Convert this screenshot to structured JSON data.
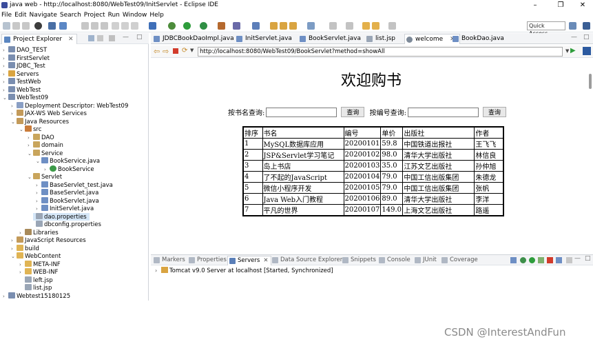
{
  "window": {
    "title": "java web - http://localhost:8080/WebTest09/InitServlet - Eclipse IDE",
    "minimize": "–",
    "maximize": "❐",
    "close": "✕"
  },
  "menu": [
    "File",
    "Edit",
    "Navigate",
    "Search",
    "Project",
    "Run",
    "Window",
    "Help"
  ],
  "toolbar": {
    "quick_access": "Quick Access"
  },
  "left_panel": {
    "tab_label": "Project Explorer",
    "tree": [
      {
        "label": "DAO_TEST"
      },
      {
        "label": "FirstServlet"
      },
      {
        "label": "JDBC_Test"
      },
      {
        "label": "Servers"
      },
      {
        "label": "TestWeb"
      },
      {
        "label": "WebTest"
      },
      {
        "label": "WebTest09"
      },
      {
        "label": "Deployment Descriptor: WebTest09"
      },
      {
        "label": "JAX-WS Web Services"
      },
      {
        "label": "Java Resources"
      },
      {
        "label": "src"
      },
      {
        "label": "DAO"
      },
      {
        "label": "domain"
      },
      {
        "label": "Service"
      },
      {
        "label": "BookService.java"
      },
      {
        "label": "BookService"
      },
      {
        "label": "Servlet"
      },
      {
        "label": "BaseServlet_test.java"
      },
      {
        "label": "BaseServlet.java"
      },
      {
        "label": "BookServlet.java"
      },
      {
        "label": "InitServlet.java"
      },
      {
        "label": "dao.properties"
      },
      {
        "label": "dbconfig.properties"
      },
      {
        "label": "Libraries"
      },
      {
        "label": "JavaScript Resources"
      },
      {
        "label": "build"
      },
      {
        "label": "WebContent"
      },
      {
        "label": "META-INF"
      },
      {
        "label": "WEB-INF"
      },
      {
        "label": "left.jsp"
      },
      {
        "label": "list.jsp"
      },
      {
        "label": "Webtest15180125"
      }
    ]
  },
  "editor_tabs": [
    {
      "label": "JDBCBookDaoImpl.java"
    },
    {
      "label": "InitServlet.java"
    },
    {
      "label": "BookServlet.java"
    },
    {
      "label": "list.jsp"
    },
    {
      "label": "welcome"
    },
    {
      "label": "BookDao.java"
    }
  ],
  "browser": {
    "url": "http://localhost:8080/WebTest09/BookServlet?method=showAll"
  },
  "page": {
    "heading": "欢迎购书",
    "search_name_label": "按书名查询:",
    "search_id_label": "按编号查询:",
    "query_button": "查询",
    "table": {
      "headers": [
        "排序",
        "书名",
        "编号",
        "单价",
        "出版社",
        "作者"
      ],
      "rows": [
        [
          "1",
          "MySQL数据库应用",
          "20200101",
          "59.8",
          "中国铁道出报社",
          "王飞飞"
        ],
        [
          "2",
          "JSP&Servlet学习笔记",
          "20200102",
          "98.0",
          "清华大学出版社",
          "林信良"
        ],
        [
          "3",
          "岛上书店",
          "20200103",
          "35.0",
          "江苏文艺出版社",
          "孙仲旭"
        ],
        [
          "4",
          "了不起的JavaScript",
          "20200104",
          "79.0",
          "中国工信出版集团",
          "朱德龙"
        ],
        [
          "5",
          "微信小程序开发",
          "20200105",
          "79.0",
          "中国工信出版集团",
          "张帆"
        ],
        [
          "6",
          "Java Web入门教程",
          "20200106",
          "89.0",
          "清华大学出版社",
          "李洋"
        ],
        [
          "7",
          "平凡的世界",
          "20200107",
          "149.0",
          "上海文艺出版社",
          "路遥"
        ]
      ]
    }
  },
  "bottom_tabs": [
    {
      "label": "Markers"
    },
    {
      "label": "Properties"
    },
    {
      "label": "Servers"
    },
    {
      "label": "Data Source Explorer"
    },
    {
      "label": "Snippets"
    },
    {
      "label": "Console"
    },
    {
      "label": "JUnit"
    },
    {
      "label": "Coverage"
    }
  ],
  "servers": {
    "entry": "Tomcat v9.0 Server at localhost  [Started, Synchronized]"
  },
  "watermark": "CSDN @InterestAndFun"
}
